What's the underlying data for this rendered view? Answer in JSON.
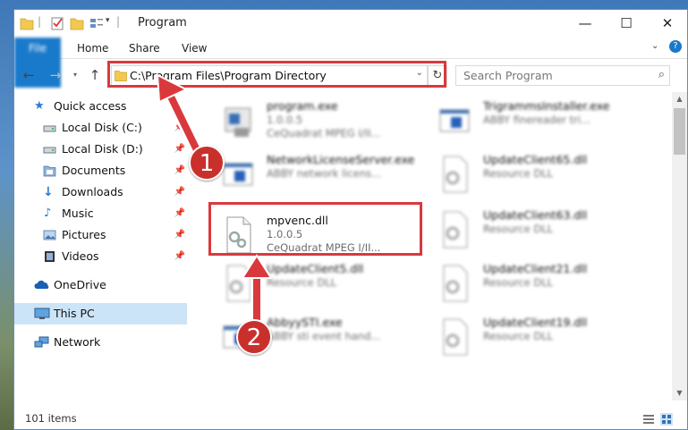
{
  "window": {
    "title": "Program"
  },
  "ribbon": {
    "tabs": [
      "File",
      "Home",
      "Share",
      "View"
    ]
  },
  "address": {
    "path": "C:\\Program Files\\Program Directory"
  },
  "search": {
    "placeholder": "Search Program"
  },
  "sidebar": {
    "items": [
      {
        "label": "Quick access",
        "icon": "star-icon"
      },
      {
        "label": "Local Disk (C:)",
        "icon": "drive-icon",
        "pinned": true
      },
      {
        "label": "Local Disk (D:)",
        "icon": "drive-icon",
        "pinned": true
      },
      {
        "label": "Documents",
        "icon": "documents-icon",
        "pinned": true
      },
      {
        "label": "Downloads",
        "icon": "downloads-icon",
        "pinned": true
      },
      {
        "label": "Music",
        "icon": "music-icon",
        "pinned": true
      },
      {
        "label": "Pictures",
        "icon": "pictures-icon",
        "pinned": true
      },
      {
        "label": "Videos",
        "icon": "videos-icon",
        "pinned": true
      },
      {
        "label": "OneDrive",
        "icon": "cloud-icon"
      },
      {
        "label": "This PC",
        "icon": "pc-icon",
        "selected": true
      },
      {
        "label": "Network",
        "icon": "network-icon"
      }
    ]
  },
  "files": [
    {
      "name": "program.exe",
      "line2": "1.0.0.5",
      "line3": "CeQuadrat MPEG I/II..."
    },
    {
      "name": "TrigrammsInstaller.exe",
      "line2": "ABBY finereader tri...",
      "line3": ""
    },
    {
      "name": "NetworkLicenseServer.exe",
      "line2": "ABBY network licens...",
      "line3": ""
    },
    {
      "name": "UpdateClient65.dll",
      "line2": "Resource DLL",
      "line3": ""
    },
    {
      "name": "mpvenc.dll",
      "line2": "1.0.0.5",
      "line3": "CeQuadrat MPEG I/II..."
    },
    {
      "name": "UpdateClient63.dll",
      "line2": "Resource DLL",
      "line3": ""
    },
    {
      "name": "UpdateClient5.dll",
      "line2": "Resource DLL",
      "line3": ""
    },
    {
      "name": "UpdateClient21.dll",
      "line2": "Resource DLL",
      "line3": ""
    },
    {
      "name": "AbbyySTI.exe",
      "line2": "ABBY sti event hand...",
      "line3": ""
    },
    {
      "name": "UpdateClient19.dll",
      "line2": "Resource DLL",
      "line3": ""
    }
  ],
  "status": {
    "count": "101 items"
  },
  "annotations": {
    "step1": "1",
    "step2": "2",
    "color": "#d9393d"
  }
}
